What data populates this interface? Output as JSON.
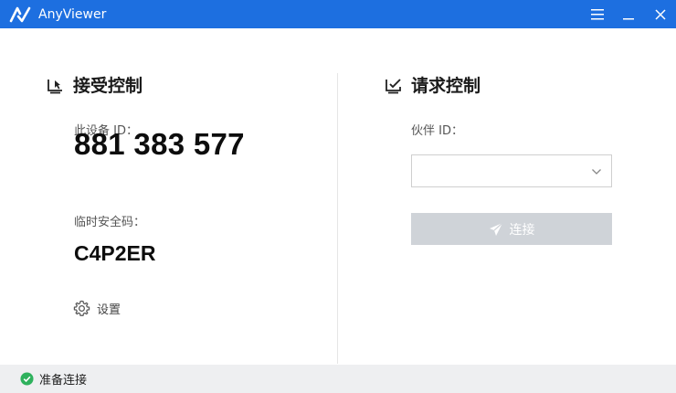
{
  "window": {
    "title": "AnyViewer",
    "accent_color": "#1d6fe0"
  },
  "receive": {
    "title": "接受控制",
    "device_id_label": "此设备 ID：",
    "device_id": "881 383 577",
    "temp_code_label": "临时安全码：",
    "temp_code": "C4P2ER",
    "settings_label": "设置"
  },
  "request": {
    "title": "请求控制",
    "partner_id_label": "伙伴 ID：",
    "partner_id_value": "",
    "connect_label": "连接",
    "connect_button_color": "#cfd3d8"
  },
  "status": {
    "text": "准备连接",
    "color": "#2eb15d"
  },
  "icons": {
    "logo": "anyviewer-logo-icon",
    "menu": "menu-icon",
    "minimize": "minimize-icon",
    "close": "close-icon",
    "receive": "monitor-cursor-icon",
    "request": "monitor-check-icon",
    "settings": "gear-icon",
    "dropdown": "chevron-down-icon",
    "connect": "send-icon",
    "status": "check-circle-icon"
  }
}
